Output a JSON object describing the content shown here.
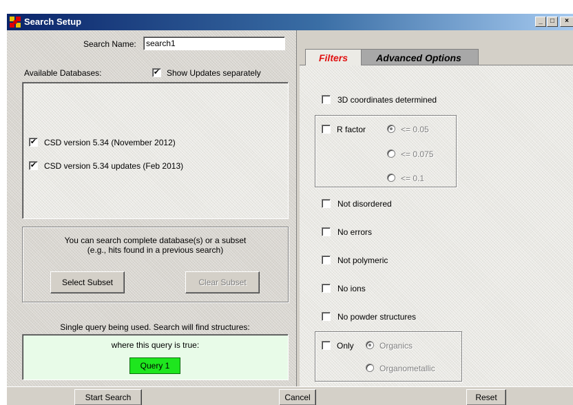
{
  "window": {
    "title": "Search Setup",
    "controls": {
      "minimize": "_",
      "maximize": "□",
      "close": "×"
    }
  },
  "left": {
    "search_name_label": "Search Name:",
    "search_name_value": "search1",
    "available_databases_label": "Available Databases:",
    "show_updates_label": "Show Updates separately",
    "show_updates_checked": "✔",
    "databases": [
      {
        "label": "CSD version 5.34 (November 2012)",
        "checked": "✔"
      },
      {
        "label": "CSD version 5.34 updates (Feb 2013)",
        "checked": "✔"
      }
    ],
    "subset_text_1": "You can search complete database(s) or a subset",
    "subset_text_2": "(e.g., hits found in a previous search)",
    "select_subset_button": "Select Subset",
    "clear_subset_button": "Clear Subset",
    "query_info": "Single query being used. Search will find structures:",
    "query_condition": "where this query is true:",
    "query_button": "Query 1"
  },
  "tabs": [
    {
      "label": "Filters",
      "active": true
    },
    {
      "label": "Advanced Options",
      "active": false
    }
  ],
  "filters": {
    "coords_3d": "3D coordinates determined",
    "r_factor": "R factor",
    "r_options": [
      "<= 0.05",
      "<= 0.075",
      "<= 0.1"
    ],
    "not_disordered": "Not disordered",
    "no_errors": "No errors",
    "not_polymeric": "Not polymeric",
    "no_ions": "No ions",
    "no_powder": "No powder structures",
    "only": "Only",
    "only_options": [
      "Organics",
      "Organometallic"
    ]
  },
  "bottom": {
    "start_search": "Start Search",
    "cancel": "Cancel",
    "reset": "Reset"
  },
  "colors": {
    "title_bar": "#0a246a",
    "query_button": "#1ee61e",
    "active_tab_text": "#e01010"
  }
}
